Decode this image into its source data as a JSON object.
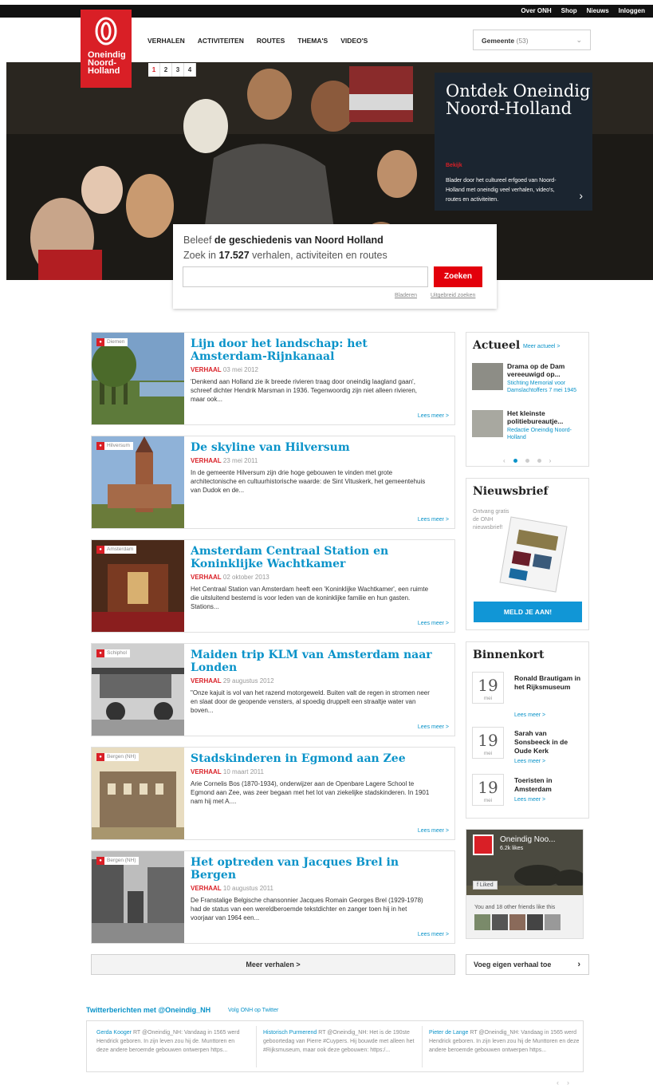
{
  "topbar": {
    "links": [
      "Over ONH",
      "Shop",
      "Nieuws",
      "Inloggen"
    ]
  },
  "logo": {
    "line1": "Oneindig",
    "line2": "Noord-",
    "line3": "Holland"
  },
  "nav": {
    "items": [
      "VERHALEN",
      "ACTIVITEITEN",
      "ROUTES",
      "THEMA'S",
      "VIDEO'S"
    ]
  },
  "gemeente": {
    "label": "Gemeente",
    "count": "(53)"
  },
  "hero": {
    "pages": [
      "1",
      "2",
      "3",
      "4"
    ],
    "title": "Ontdek Oneindig Noord-Holland",
    "bekijk": "Bekijk",
    "desc": "Blader door het cultureel erfgoed van Noord-Holland met oneindig veel verhalen, video's, routes en activiteiten."
  },
  "search": {
    "line1_pre": "Beleef ",
    "line1_bold": "de geschiedenis van Noord Holland",
    "line2_pre": "Zoek in ",
    "line2_bold": "17.527",
    "line2_post": " verhalen, activiteiten en routes",
    "button": "Zoeken",
    "bladeren": "Bladeren",
    "uitgebreid": "Uitgebreid zoeken"
  },
  "stories": [
    {
      "location": "Diemen",
      "title": "Lijn door het landschap: het Amsterdam-Rijnkanaal",
      "type": "VERHAAL",
      "date": "03 mei 2012",
      "excerpt": "'Denkend aan Holland zie ik breede rivieren traag door oneindig laagland gaan', schreef dichter Hendrik Marsman in 1936. Tegenwoordig zijn niet alleen rivieren, maar ook...",
      "more": "Lees meer >"
    },
    {
      "location": "Hilversum",
      "title": "De skyline van Hilversum",
      "type": "VERHAAL",
      "date": "23 mei 2011",
      "excerpt": "In de gemeente Hilversum zijn drie hoge gebouwen te vinden met grote architectonische en cultuurhistorische waarde: de Sint Vituskerk, het gemeentehuis van Dudok en de...",
      "more": "Lees meer >"
    },
    {
      "location": "Amsterdam",
      "title": "Amsterdam Centraal Station en Koninklijke Wachtkamer",
      "type": "VERHAAL",
      "date": "02 oktober 2013",
      "excerpt": "Het Centraal Station van Amsterdam heeft een 'Koninklijke Wachtkamer', een ruimte die uitsluitend bestemd is voor leden van de koninklijke familie en hun gasten. Stations...",
      "more": "Lees meer >"
    },
    {
      "location": "Schiphol",
      "title": "Maiden trip KLM van Amsterdam naar Londen",
      "type": "VERHAAL",
      "date": "29 augustus 2012",
      "excerpt": "\"Onze kajuit is vol van het razend motorgeweld. Buiten valt de regen in stromen neer en slaat door de geopende vensters, al spoedig druppelt een straaltje water van boven...",
      "more": "Lees meer >"
    },
    {
      "location": "Bergen (NH)",
      "title": "Stadskinderen in Egmond aan Zee",
      "type": "VERHAAL",
      "date": "10 maart 2011",
      "excerpt": "Arie Cornelis Bos (1870-1934), onderwijzer aan de Openbare Lagere School te Egmond aan Zee, was zeer begaan met het lot van ziekelijke stadskinderen. In 1901 nam hij met A....",
      "more": "Lees meer >"
    },
    {
      "location": "Bergen (NH)",
      "title": "Het optreden van Jacques Brel in Bergen",
      "type": "VERHAAL",
      "date": "10 augustus 2011",
      "excerpt": "De Franstalige Belgische chansonnier Jacques Romain Georges Brel (1929-1978) had de status van een wereldberoemde tekstdichter en zanger toen hij in het voorjaar van 1964 een...",
      "more": "Lees meer >"
    }
  ],
  "meer_verhalen": "Meer verhalen >",
  "actueel": {
    "title": "Actueel",
    "more": "Meer actueel >",
    "items": [
      {
        "title": "Drama op de Dam vereeuwigd op...",
        "source": "Stichting Memorial voor Damslachtoffers 7 mei 1945"
      },
      {
        "title": "Het kleinste politiebureautje...",
        "source": "Redactie Oneindig Noord-Holland"
      }
    ]
  },
  "nieuwsbrief": {
    "title": "Nieuwsbrief",
    "text": "Ontvang gratis de ONH nieuwsbrief!",
    "button": "MELD JE AAN!"
  },
  "binnenkort": {
    "title": "Binnenkort",
    "items": [
      {
        "day": "19",
        "month": "mei",
        "title": "Ronald Brautigam in het Rijksmuseum",
        "more": "Lees meer >"
      },
      {
        "day": "19",
        "month": "mei",
        "title": "Sarah van Sonsbeeck in de Oude Kerk",
        "more": "Lees meer >"
      },
      {
        "day": "19",
        "month": "mei",
        "title": "Toeristen in Amsterdam",
        "more": "Lees meer >"
      }
    ]
  },
  "facebook": {
    "name": "Oneindig Noo...",
    "likes": "6.2k likes",
    "liked": "Liked",
    "friends": "You and 18 other friends like this"
  },
  "voeg": {
    "label": "Voeg eigen verhaal toe"
  },
  "twitter": {
    "title": "Twitterberichten met @Oneindig_NH",
    "follow": "Volg ONH op Twitter",
    "tweets": [
      {
        "name": "Gerda Kooger",
        "text": "RT @Oneindig_NH: Vandaag in 1565 werd Hendrick geboren. In zijn leven zou hij de. Munttoren en deze andere beroemde gebouwen ontwerpen https..."
      },
      {
        "name": "Historisch Purmerend",
        "text": "RT @Oneindig_NH: Het is de 190ste geboortedag van Pierre #Cuypers. Hij bouwde met alleen het #Rijksmuseum, maar ook deze gebouwen: https:/..."
      },
      {
        "name": "Pieter de Lange",
        "text": "RT @Oneindig_NH: Vandaag in 1565 werd Hendrick geboren. In zijn leven zou hij de Munttoren en deze andere beroemde gebouwen ontwerpen https..."
      }
    ]
  },
  "colors": {
    "brand_red": "#d91f26",
    "link_blue": "#0a93c9",
    "search_red": "#e3000b",
    "hero_bg": "#1c1a16",
    "ontdek_bg": "#1b2530"
  }
}
